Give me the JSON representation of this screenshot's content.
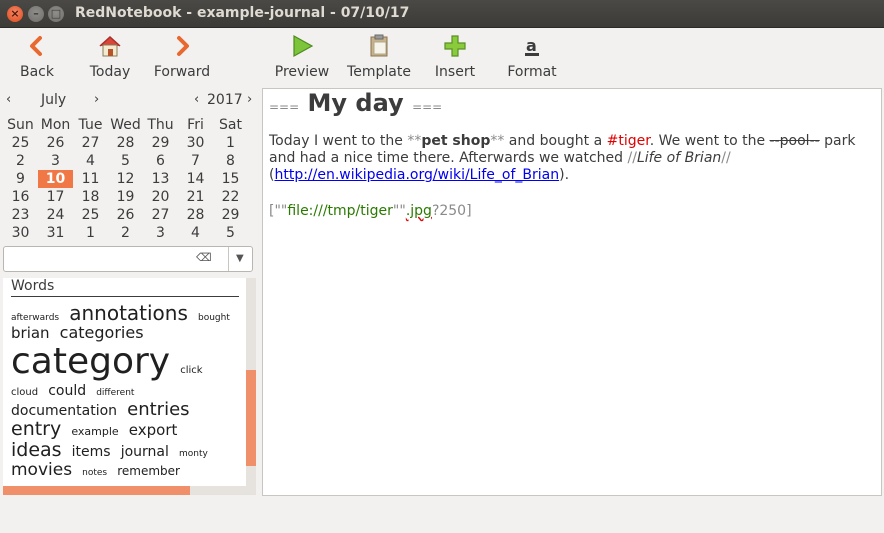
{
  "window": {
    "title": "RedNotebook - example-journal - 07/10/17",
    "close_glyph": "×",
    "min_glyph": "–",
    "max_glyph": "□"
  },
  "toolbar": {
    "back": "Back",
    "today": "Today",
    "forward": "Forward",
    "preview": "Preview",
    "template": "Template",
    "insert": "Insert",
    "format": "Format"
  },
  "calendar": {
    "month": "July",
    "year": "2017",
    "prev_glyph": "‹",
    "next_glyph": "›",
    "weekdays": [
      "Sun",
      "Mon",
      "Tue",
      "Wed",
      "Thu",
      "Fri",
      "Sat"
    ],
    "weeks": [
      [
        "25",
        "26",
        "27",
        "28",
        "29",
        "30",
        "1"
      ],
      [
        "2",
        "3",
        "4",
        "5",
        "6",
        "7",
        "8"
      ],
      [
        "9",
        "10",
        "11",
        "12",
        "13",
        "14",
        "15"
      ],
      [
        "16",
        "17",
        "18",
        "19",
        "20",
        "21",
        "22"
      ],
      [
        "23",
        "24",
        "25",
        "26",
        "27",
        "28",
        "29"
      ],
      [
        "30",
        "31",
        "1",
        "2",
        "3",
        "4",
        "5"
      ]
    ],
    "selected": "10"
  },
  "search": {
    "value": "",
    "placeholder": "",
    "clear_glyph": "⌫",
    "dropdown_glyph": "▼"
  },
  "cloud": {
    "header": "Words",
    "words": [
      {
        "t": "afterwards",
        "s": 9
      },
      {
        "t": "annotations",
        "s": 20
      },
      {
        "t": "bought",
        "s": 9
      },
      {
        "t": "brian",
        "s": 15
      },
      {
        "t": "categories",
        "s": 16
      },
      {
        "t": "category",
        "s": 36
      },
      {
        "t": "click",
        "s": 10
      },
      {
        "t": "cloud",
        "s": 10
      },
      {
        "t": "could",
        "s": 14
      },
      {
        "t": "different",
        "s": 9
      },
      {
        "t": "documentation",
        "s": 14
      },
      {
        "t": "entries",
        "s": 18
      },
      {
        "t": "entry",
        "s": 19
      },
      {
        "t": "example",
        "s": 11
      },
      {
        "t": "export",
        "s": 15
      },
      {
        "t": "ideas",
        "s": 19
      },
      {
        "t": "items",
        "s": 14
      },
      {
        "t": "journal",
        "s": 14
      },
      {
        "t": "monty",
        "s": 9
      },
      {
        "t": "movies",
        "s": 17
      },
      {
        "t": "notes",
        "s": 9
      },
      {
        "t": "remember",
        "s": 12
      }
    ]
  },
  "editor": {
    "heading_marker": "===",
    "heading": "My day",
    "p1_a": "Today I went to the ",
    "bold_open": "**",
    "bold_text": "pet shop",
    "bold_close": "**",
    "p1_b": " and bought a ",
    "tag": "#tiger",
    "p1_c": ". We went to the ",
    "strike_open": "--",
    "strike_text": "pool",
    "strike_close": "--",
    "p1_d": " park and had a nice time there. Afterwards we watched ",
    "ital_open": "//",
    "ital_text": "Life of Brian",
    "ital_close": "//",
    "p1_e": " (",
    "link": "http://en.wikipedia.org/wiki/Life_of_Brian",
    "p1_f": ").",
    "img_open": "[",
    "img_q1": "\"\"",
    "img_path": "file:///tmp/tiger",
    "img_q2": "\"\"",
    "img_ext": ".jpg",
    "img_size": "?250]"
  },
  "colors": {
    "accent": "#f07746",
    "link": "#0000ee",
    "tag": "#e00000",
    "image_link": "#2a7a00"
  }
}
